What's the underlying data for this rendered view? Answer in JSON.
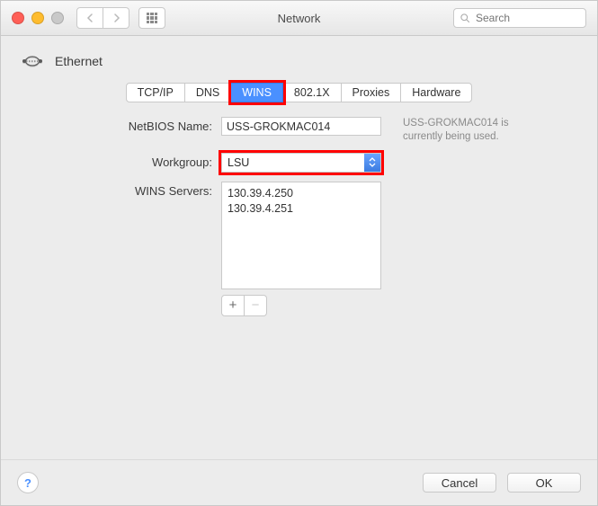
{
  "window": {
    "title": "Network",
    "search_placeholder": "Search"
  },
  "header": {
    "interface_label": "Ethernet"
  },
  "tabs": [
    {
      "label": "TCP/IP"
    },
    {
      "label": "DNS"
    },
    {
      "label": "WINS",
      "active": true,
      "highlighted": true
    },
    {
      "label": "802.1X"
    },
    {
      "label": "Proxies"
    },
    {
      "label": "Hardware"
    }
  ],
  "form": {
    "netbios": {
      "label": "NetBIOS Name:",
      "value": "USS-GROKMAC014",
      "hint": "USS-GROKMAC014 is currently being used."
    },
    "workgroup": {
      "label": "Workgroup:",
      "value": "LSU",
      "highlighted": true
    },
    "wins_servers": {
      "label": "WINS Servers:",
      "items": [
        "130.39.4.250",
        "130.39.4.251"
      ]
    }
  },
  "footer": {
    "help_label": "?",
    "cancel_label": "Cancel",
    "ok_label": "OK"
  }
}
